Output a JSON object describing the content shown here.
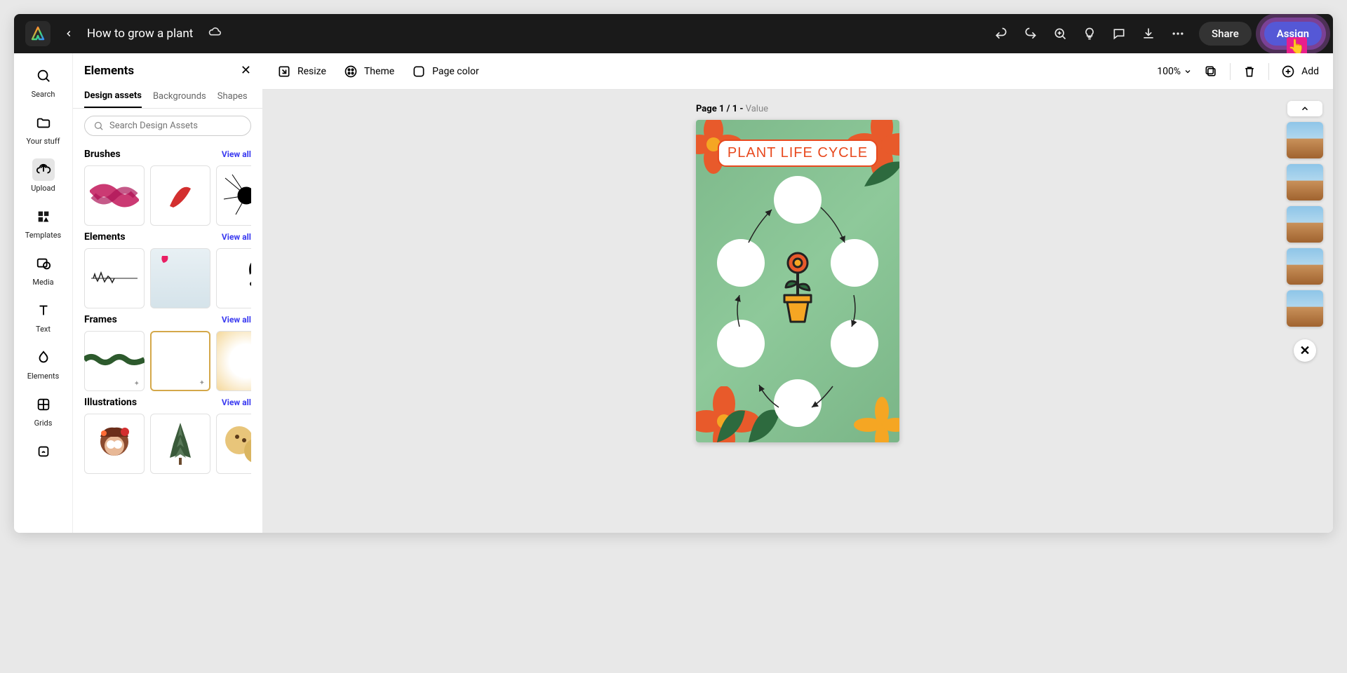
{
  "header": {
    "title": "How to grow a plant",
    "share_label": "Share",
    "assign_label": "Assign"
  },
  "rail": {
    "items": [
      {
        "label": "Search"
      },
      {
        "label": "Your stuff"
      },
      {
        "label": "Upload"
      },
      {
        "label": "Templates"
      },
      {
        "label": "Media"
      },
      {
        "label": "Text"
      },
      {
        "label": "Elements"
      },
      {
        "label": "Grids"
      }
    ]
  },
  "panel": {
    "title": "Elements",
    "tabs": [
      "Design assets",
      "Backgrounds",
      "Shapes"
    ],
    "search_placeholder": "Search Design Assets",
    "view_all": "View all",
    "sections": [
      {
        "title": "Brushes"
      },
      {
        "title": "Elements"
      },
      {
        "title": "Frames"
      },
      {
        "title": "Illustrations"
      }
    ]
  },
  "toolbar": {
    "resize": "Resize",
    "theme": "Theme",
    "page_color": "Page color",
    "zoom": "100%",
    "add": "Add"
  },
  "canvas": {
    "page_label_prefix": "Page 1 / 1 - ",
    "page_label_value": "Value",
    "design_title": "PLANT LIFE CYCLE"
  }
}
